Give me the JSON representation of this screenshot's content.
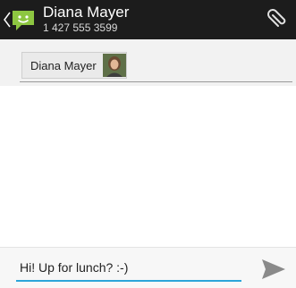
{
  "header": {
    "contact_name": "Diana Mayer",
    "contact_phone": "1 427 555 3599",
    "back_icon": "chevron-left-icon",
    "app_icon": "messages-app-icon",
    "attach_icon": "paperclip-icon",
    "accent_color": "#8dc641"
  },
  "recipient": {
    "chip_label": "Diana Mayer",
    "avatar": "contact-photo"
  },
  "compose": {
    "message_text": "Hi! Up for lunch? :-)",
    "send_icon": "send-icon",
    "underline_color": "#2ba5d9"
  }
}
